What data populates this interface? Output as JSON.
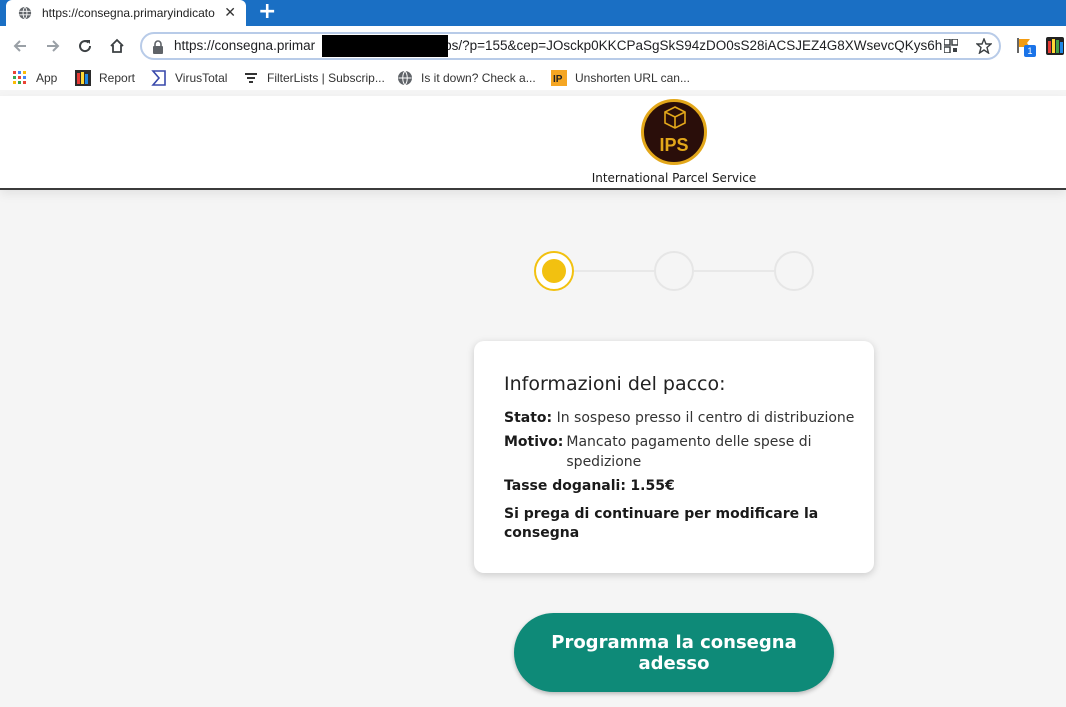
{
  "browser": {
    "tab_title": "https://consegna.primaryindicato",
    "new_tab_label": "+",
    "close_label": "✕",
    "url_prefix": "https://consegna.primar",
    "url_suffix": "ips/?p=155&cep=JOsckp0KKCPaSgSkS94zDO0sS28iACSJEZ4G8XWsevcQKys6h",
    "extension_badge": "1"
  },
  "bookmarks": [
    {
      "label": "App",
      "icon": "apps-grid-icon"
    },
    {
      "label": "Report",
      "icon": "report-icon"
    },
    {
      "label": "VirusTotal",
      "icon": "virustotal-icon"
    },
    {
      "label": "FilterLists | Subscrip...",
      "icon": "filter-icon"
    },
    {
      "label": "Is it down? Check a...",
      "icon": "globe-icon"
    },
    {
      "label": "Unshorten URL can...",
      "icon": "ip-icon"
    }
  ],
  "site": {
    "logo_text": "IPS",
    "company_name": "International Parcel Service"
  },
  "stepper": {
    "total_steps": 3,
    "active_step": 1
  },
  "card": {
    "title": "Informazioni del pacco:",
    "stato_label": "Stato:",
    "stato_value": "In sospeso presso il centro di distribuzione",
    "motivo_label": "Motivo:",
    "motivo_value": "Mancato pagamento delle spese di spedizione",
    "tasse_label": "Tasse doganali:",
    "tasse_value": "1.55€",
    "note": "Si prega di continuare per modificare la consegna"
  },
  "cta": {
    "label": "Programma la consegna adesso"
  },
  "colors": {
    "tab_strip": "#1a6fc4",
    "accent_yellow": "#f2c110",
    "cta_green": "#0e8a78",
    "logo_gold": "#e3a71a"
  }
}
